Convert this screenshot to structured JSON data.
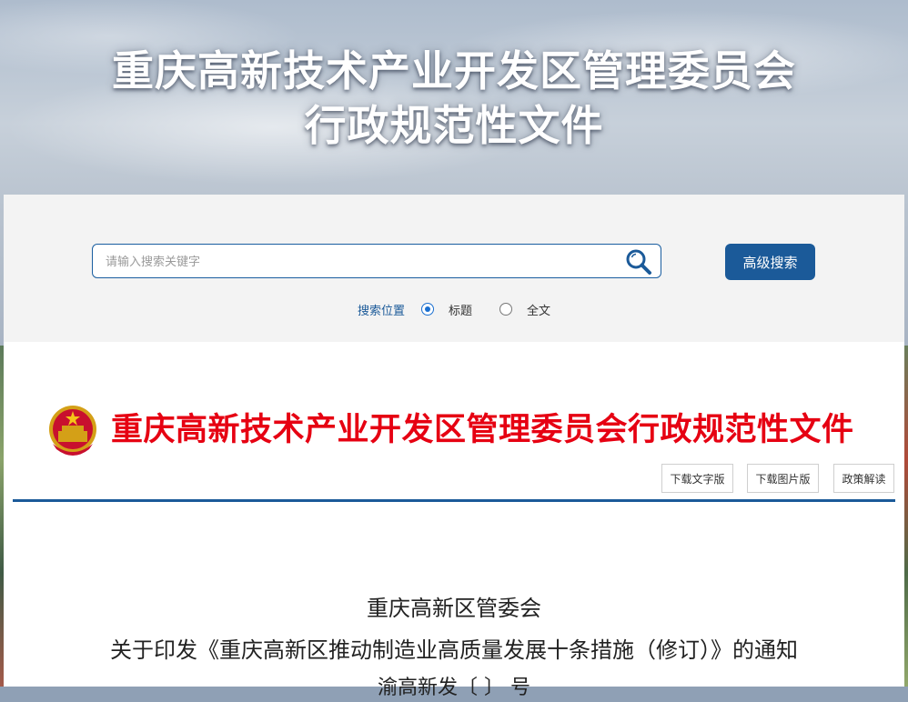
{
  "hero": {
    "title_line1": "重庆高新技术产业开发区管理委员会",
    "title_line2": "行政规范性文件"
  },
  "search": {
    "placeholder": "请输入搜索关键字",
    "advanced_button": "高级搜索",
    "scope_label": "搜索位置",
    "options": [
      {
        "label": "标题",
        "selected": true
      },
      {
        "label": "全文",
        "selected": false
      }
    ]
  },
  "document": {
    "header_title": "重庆高新技术产业开发区管理委员会行政规范性文件",
    "buttons": {
      "download_text": "下载文字版",
      "download_image": "下载图片版",
      "policy_interpretation": "政策解读"
    },
    "issuer": "重庆高新区管委会",
    "notice_title": "关于印发《重庆高新区推动制造业高质量发展十条措施（修订）》的通知",
    "doc_number": "渝高新发〔    〕    号"
  },
  "colors": {
    "brand_blue": "#1b5a99",
    "title_red": "#e60012"
  }
}
